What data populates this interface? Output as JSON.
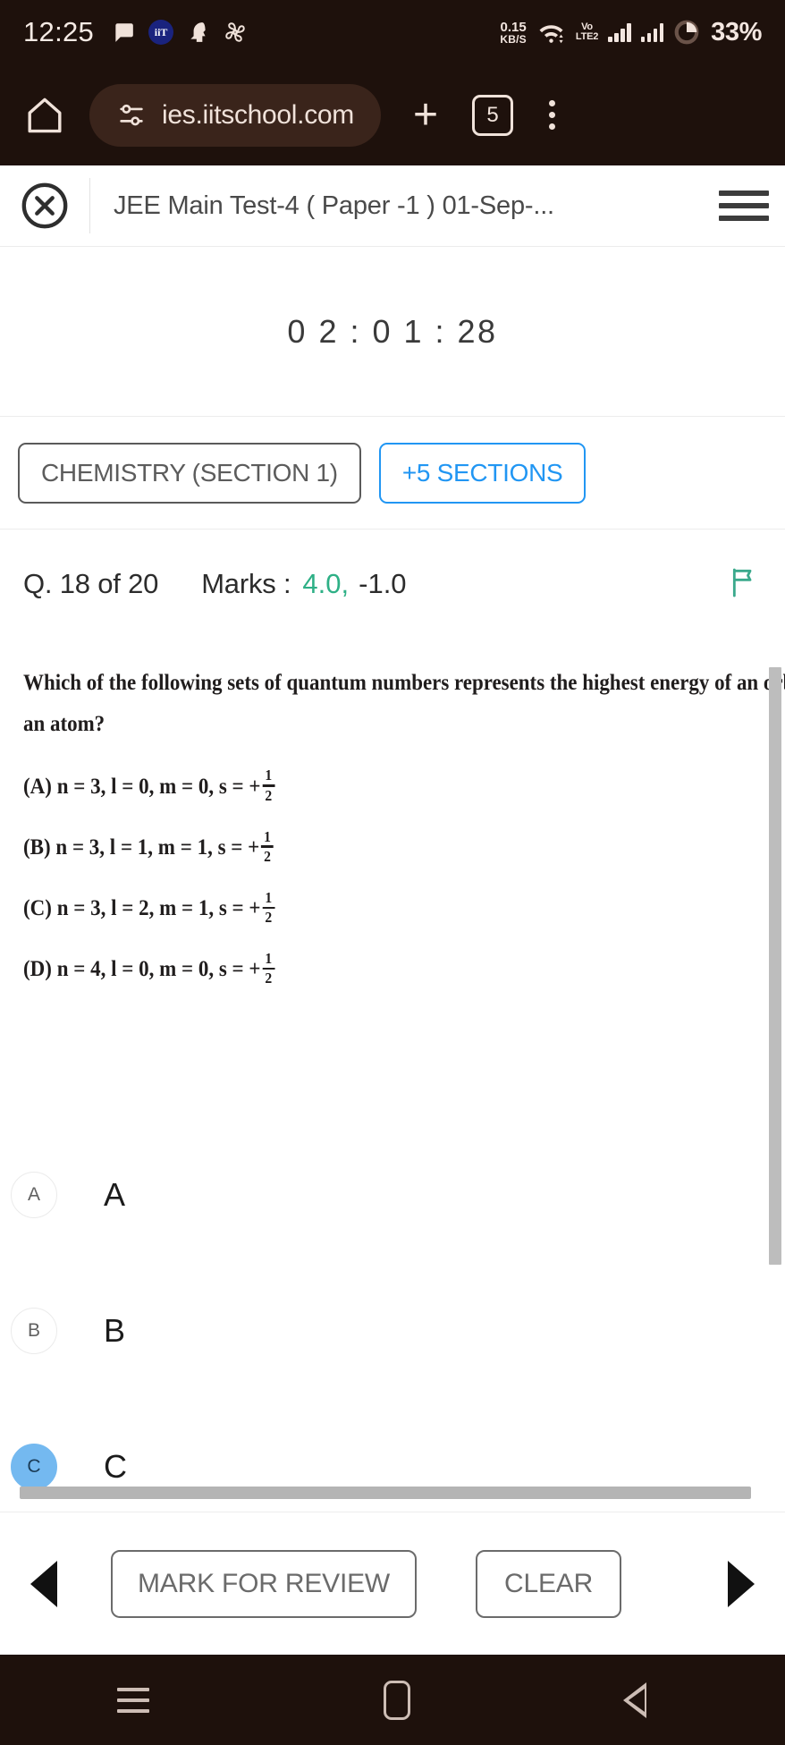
{
  "status_bar": {
    "clock": "12:25",
    "icons": [
      "chat-bubble-icon",
      "iit-app-icon",
      "head-profile-icon",
      "fan-icon"
    ],
    "iit_badge": "iiT",
    "data_rate_value": "0.15",
    "data_rate_unit": "KB/S",
    "wifi": "wifi-icon",
    "volte_line1": "Vo",
    "volte_line2": "LTE2",
    "signal_1": "signal-bars-icon",
    "signal_2": "signal-bars-icon",
    "battery": "33%"
  },
  "browser": {
    "home_icon": "home-icon",
    "site_settings_icon": "tune-sliders-icon",
    "url": "ies.iitschool.com",
    "new_tab_label": "+",
    "tab_count": "5",
    "menu_icon": "kebab-menu-icon"
  },
  "app_header": {
    "close_icon": "close-circle-icon",
    "title": "JEE Main Test-4 ( Paper -1 ) 01-Sep-...",
    "menu_icon": "hamburger-menu-icon"
  },
  "timer": {
    "value": "0 2 : 0 1 : 28"
  },
  "sections": {
    "current": "CHEMISTRY (SECTION 1)",
    "more": "+5 SECTIONS",
    "accent_color": "#2196f3"
  },
  "question_meta": {
    "index": "Q. 18 of 20",
    "marks_label": "Marks :",
    "positive": "4.0,",
    "negative": "-1.0",
    "positive_color": "#2eb086",
    "flag_icon": "flag-icon",
    "flag_color": "#3aa98c"
  },
  "question": {
    "line1": "Which of the following sets of quantum numbers represents the highest energy of an orbital in",
    "line2": "an atom?",
    "options": [
      {
        "tag": "(A)",
        "body": "n = 3, l = 0, m = 0, s = +",
        "num": "1",
        "den": "2"
      },
      {
        "tag": "(B)",
        "body": "n = 3, l = 1, m = 1, s = +",
        "num": "1",
        "den": "2"
      },
      {
        "tag": "(C)",
        "body": "n = 3, l = 2, m = 1, s = +",
        "num": "1",
        "den": "2"
      },
      {
        "tag": "(D)",
        "body": "n = 4, l = 0, m = 0, s = +",
        "num": "1",
        "den": "2"
      }
    ]
  },
  "choices": [
    {
      "key": "A",
      "label": "A",
      "selected": false
    },
    {
      "key": "B",
      "label": "B",
      "selected": false
    },
    {
      "key": "C",
      "label": "C",
      "selected": true
    }
  ],
  "selected_color": "#74b9f0",
  "bottom_toolbar": {
    "prev_icon": "previous-arrow-icon",
    "mark_for_review": "MARK FOR REVIEW",
    "clear": "CLEAR",
    "next_icon": "next-arrow-icon"
  },
  "android_navbar": {
    "recents_icon": "recents-icon",
    "home_icon": "home-square-icon",
    "back_icon": "back-triangle-icon"
  }
}
